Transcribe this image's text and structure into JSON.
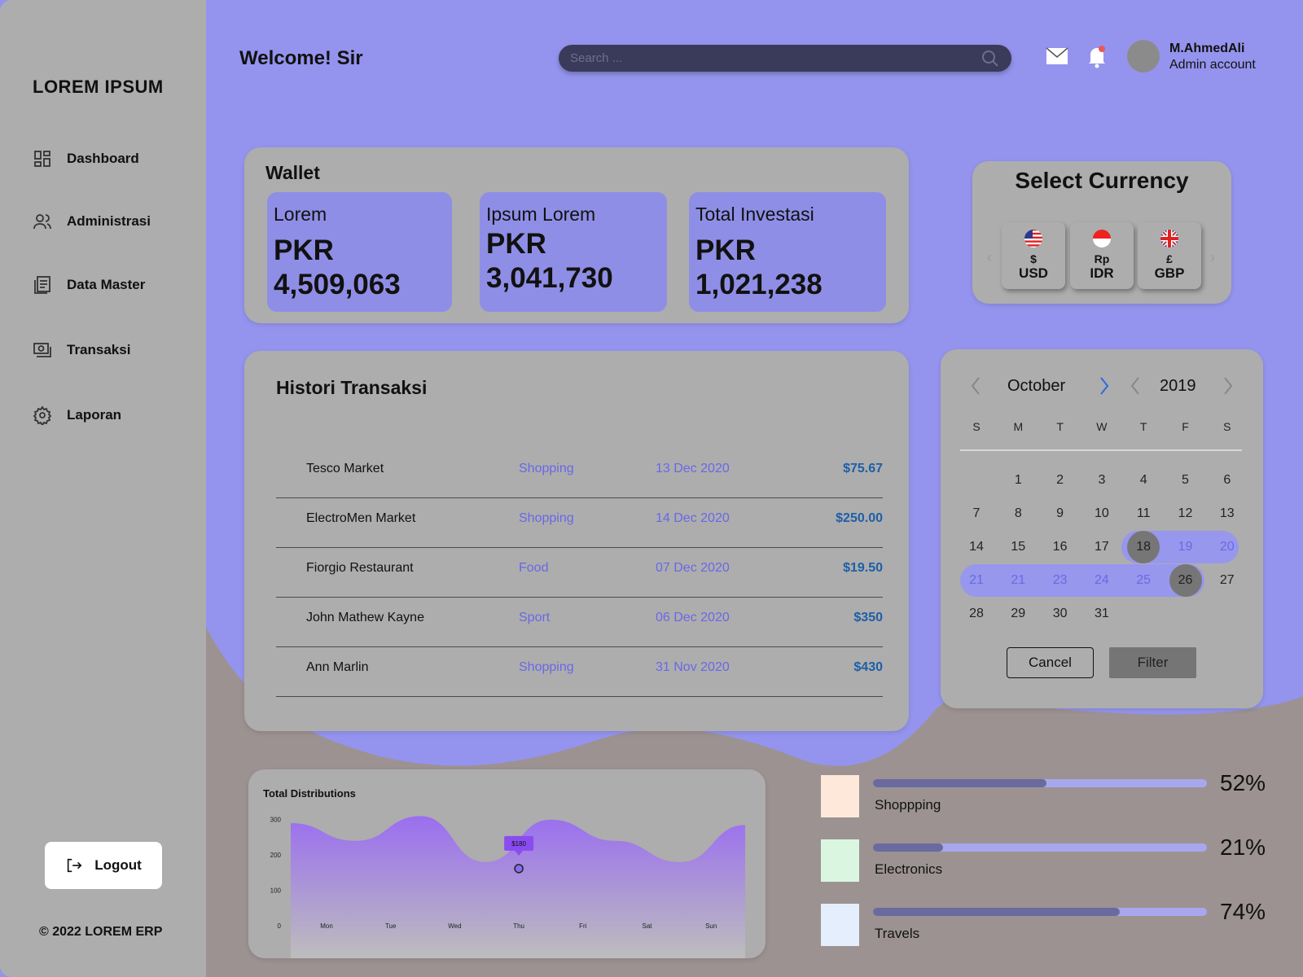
{
  "sidebar": {
    "brand": "LOREM IPSUM",
    "items": [
      {
        "label": "Dashboard"
      },
      {
        "label": "Administrasi"
      },
      {
        "label": "Data Master"
      },
      {
        "label": "Transaksi"
      },
      {
        "label": "Laporan"
      }
    ],
    "logout_label": "Logout",
    "copyright": "© 2022 LOREM ERP"
  },
  "header": {
    "welcome": "Welcome! Sir",
    "search_placeholder": "Search ...",
    "user_name": "M.AhmedAli",
    "user_role": "Admin account"
  },
  "wallet": {
    "title": "Wallet",
    "boxes": [
      {
        "label": "Lorem",
        "currency": "PKR",
        "amount": "4,509,063"
      },
      {
        "label": "Ipsum Lorem",
        "currency": "PKR",
        "amount": "3,041,730"
      },
      {
        "label": "Total Investasi",
        "currency": "PKR",
        "amount": "1,021,238"
      }
    ]
  },
  "currency": {
    "title": "Select Currency",
    "options": [
      {
        "symbol": "$",
        "code": "USD",
        "flag": "us-flag-icon"
      },
      {
        "symbol": "Rp",
        "code": "IDR",
        "flag": "id-flag-icon"
      },
      {
        "symbol": "£",
        "code": "GBP",
        "flag": "uk-flag-icon"
      }
    ]
  },
  "history": {
    "title": "Histori Transaksi",
    "rows": [
      {
        "name": "Tesco Market",
        "category": "Shopping",
        "date": "13 Dec 2020",
        "amount": "$75.67"
      },
      {
        "name": "ElectroMen Market",
        "category": "Shopping",
        "date": "14 Dec 2020",
        "amount": "$250.00"
      },
      {
        "name": "Fiorgio Restaurant",
        "category": "Food",
        "date": "07 Dec 2020",
        "amount": "$19.50"
      },
      {
        "name": "John Mathew Kayne",
        "category": "Sport",
        "date": "06 Dec 2020",
        "amount": "$350"
      },
      {
        "name": "Ann Marlin",
        "category": "Shopping",
        "date": "31 Nov 2020",
        "amount": "$430"
      }
    ]
  },
  "calendar": {
    "month": "October",
    "year": "2019",
    "weekdays": [
      "S",
      "M",
      "T",
      "W",
      "T",
      "F",
      "S"
    ],
    "weeks": [
      [
        "",
        "1",
        "2",
        "3",
        "4",
        "5",
        "6"
      ],
      [
        "7",
        "8",
        "9",
        "10",
        "11",
        "12",
        "13"
      ],
      [
        "14",
        "15",
        "16",
        "17",
        "18",
        "19",
        "20"
      ],
      [
        "21",
        "21",
        "23",
        "24",
        "25",
        "26",
        "27"
      ],
      [
        "28",
        "29",
        "30",
        "31",
        "",
        "",
        ""
      ]
    ],
    "range_start": "18",
    "range_end": "26",
    "cancel_label": "Cancel",
    "filter_label": "Filter"
  },
  "distribution": {
    "title": "Total Distributions",
    "tooltip": "$180"
  },
  "chart_data": {
    "type": "area",
    "title": "Total Distributions",
    "categories": [
      "Mon",
      "Tue",
      "Wed",
      "Thu",
      "Fri",
      "Sat",
      "Sun"
    ],
    "yticks": [
      "0",
      "100",
      "200",
      "300"
    ],
    "ylim": [
      0,
      350
    ],
    "series": [
      {
        "values": [
          290,
          240,
          310,
          180,
          300,
          240,
          180,
          285
        ]
      }
    ],
    "highlight": {
      "category": "Thu",
      "label": "$180",
      "value": 180
    },
    "gradient_top": "#9a6ef0",
    "gradient_bottom": "#bdbdbd"
  },
  "categories": [
    {
      "name": "Shoppping",
      "percent": "52%",
      "value": 0.52,
      "color": "#fde8da"
    },
    {
      "name": "Electronics",
      "percent": "21%",
      "value": 0.21,
      "color": "#dbf6e0"
    },
    {
      "name": "Travels",
      "percent": "74%",
      "value": 0.74,
      "color": "#e4eefc"
    }
  ]
}
